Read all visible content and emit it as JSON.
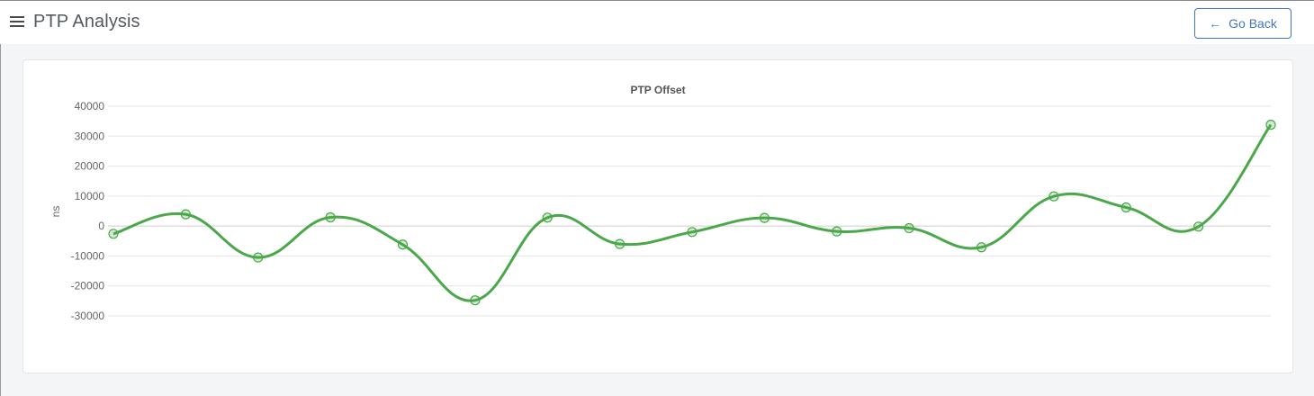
{
  "header": {
    "title": "PTP Analysis",
    "menu_icon": "hamburger-menu-icon",
    "go_back_label": "Go Back",
    "go_back_icon": "arrow-left-icon"
  },
  "colors": {
    "accent": "#3f77c4",
    "series": "#4aa84a"
  },
  "chart_data": {
    "type": "line",
    "title": "PTP Offset",
    "xlabel": "",
    "ylabel": "ns",
    "ylim": [
      -30000,
      40000
    ],
    "yticks": [
      40000,
      30000,
      20000,
      10000,
      0,
      -10000,
      -20000,
      -30000
    ],
    "grid": true,
    "legend": "none",
    "x": [
      1,
      2,
      3,
      4,
      5,
      6,
      7,
      8,
      9,
      10,
      11,
      12,
      13,
      14,
      15,
      16,
      17
    ],
    "series": [
      {
        "values": [
          -2600,
          3900,
          -10500,
          2900,
          -6200,
          -24800,
          2800,
          -6000,
          -2000,
          2700,
          -1800,
          -700,
          -7100,
          9900,
          6200,
          -200,
          33800
        ]
      }
    ]
  }
}
